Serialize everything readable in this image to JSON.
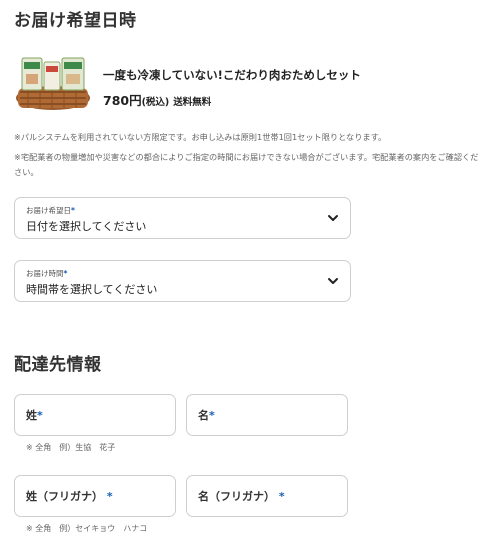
{
  "delivery": {
    "title": "お届け希望日時",
    "product": {
      "name": "一度も冷凍していない!こだわり肉おためしセット",
      "price": "780円",
      "tax": "(税込)",
      "shipping": "送料無料"
    },
    "notices": [
      "※パルシステムを利用されていない方限定です。お申し込みは原則1世帯1回1セット限りとなります。",
      "※宅配業者の物量増加や災害などの都合によりご指定の時間にお届けできない場合がございます。宅配業者の案内をご確認ください。"
    ],
    "date_select": {
      "label": "お届け希望日",
      "required": "*",
      "value": "日付を選択してください"
    },
    "time_select": {
      "label": "お届け時間",
      "required": "*",
      "value": "時間帯を選択してください"
    }
  },
  "address": {
    "title": "配達先情報",
    "last_name": {
      "label": "姓",
      "required": "*"
    },
    "first_name": {
      "label": "名",
      "required": "*"
    },
    "name_hint": "※ 全角　例）生協　花子",
    "last_kana": {
      "label": "姓（フリガナ）",
      "required": "*"
    },
    "first_kana": {
      "label": "名（フリガナ）",
      "required": "*"
    },
    "kana_hint": "※ 全角　例）セイキョウ　ハナコ"
  },
  "colors": {
    "required_marker": "#1a5fb4",
    "border": "#cfcfcf"
  },
  "icons": {
    "select_arrow": "chevron-down-icon"
  }
}
